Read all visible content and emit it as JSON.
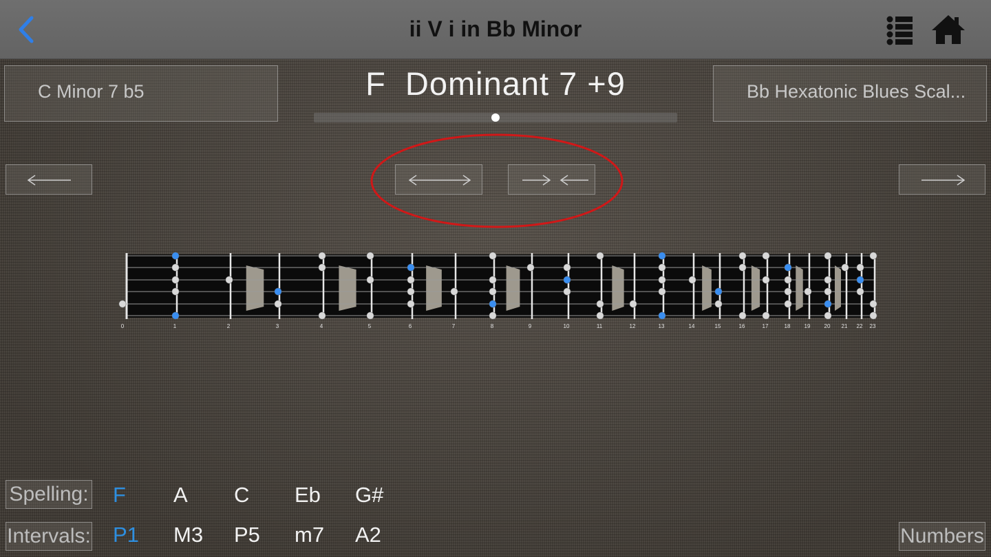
{
  "header": {
    "title": "ii V i in Bb Minor",
    "back_icon": "chevron-left-icon",
    "list_icon": "list-icon",
    "home_icon": "home-icon",
    "back_color": "#2f7fe8"
  },
  "chords": {
    "previous": "C  Minor 7 b5",
    "current": "F  Dominant 7 +9",
    "next": "Bb Hexatonic Blues Scal..."
  },
  "position_slider": {
    "value": 0.5
  },
  "navigation": {
    "prev_icon": "arrow-left-icon",
    "next_icon": "arrow-right-icon",
    "expand_icon": "arrows-expand-icon",
    "contract_icon": "arrows-contract-icon",
    "highlight_color": "#d01818"
  },
  "fretboard": {
    "fret_numbers": [
      "0",
      "1",
      "2",
      "3",
      "4",
      "5",
      "6",
      "7",
      "8",
      "9",
      "10",
      "11",
      "12",
      "13",
      "14",
      "15",
      "16",
      "17",
      "18",
      "19",
      "20",
      "21",
      "22",
      "23"
    ],
    "inlay_frets": [
      3,
      5,
      7,
      9,
      12,
      15,
      17,
      19,
      21
    ],
    "root_color": "#3a8ef0",
    "note_color": "#d8d8d8",
    "notes": [
      {
        "fret": 0,
        "string": 5,
        "root": false
      },
      {
        "fret": 1,
        "string": 1,
        "root": true
      },
      {
        "fret": 1,
        "string": 2,
        "root": false
      },
      {
        "fret": 1,
        "string": 3,
        "root": false
      },
      {
        "fret": 1,
        "string": 4,
        "root": false
      },
      {
        "fret": 1,
        "string": 6,
        "root": true
      },
      {
        "fret": 2,
        "string": 3,
        "root": false
      },
      {
        "fret": 3,
        "string": 4,
        "root": true
      },
      {
        "fret": 3,
        "string": 5,
        "root": false
      },
      {
        "fret": 4,
        "string": 1,
        "root": false
      },
      {
        "fret": 4,
        "string": 2,
        "root": false
      },
      {
        "fret": 4,
        "string": 6,
        "root": false
      },
      {
        "fret": 5,
        "string": 1,
        "root": false
      },
      {
        "fret": 5,
        "string": 3,
        "root": false
      },
      {
        "fret": 5,
        "string": 6,
        "root": false
      },
      {
        "fret": 6,
        "string": 2,
        "root": true
      },
      {
        "fret": 6,
        "string": 3,
        "root": false
      },
      {
        "fret": 6,
        "string": 4,
        "root": false
      },
      {
        "fret": 6,
        "string": 5,
        "root": false
      },
      {
        "fret": 7,
        "string": 4,
        "root": false
      },
      {
        "fret": 8,
        "string": 1,
        "root": false
      },
      {
        "fret": 8,
        "string": 3,
        "root": false
      },
      {
        "fret": 8,
        "string": 4,
        "root": false
      },
      {
        "fret": 8,
        "string": 5,
        "root": true
      },
      {
        "fret": 8,
        "string": 6,
        "root": false
      },
      {
        "fret": 9,
        "string": 2,
        "root": false
      },
      {
        "fret": 10,
        "string": 2,
        "root": false
      },
      {
        "fret": 10,
        "string": 3,
        "root": true
      },
      {
        "fret": 10,
        "string": 4,
        "root": false
      },
      {
        "fret": 11,
        "string": 1,
        "root": false
      },
      {
        "fret": 11,
        "string": 5,
        "root": false
      },
      {
        "fret": 11,
        "string": 6,
        "root": false
      },
      {
        "fret": 12,
        "string": 5,
        "root": false
      },
      {
        "fret": 13,
        "string": 1,
        "root": true
      },
      {
        "fret": 13,
        "string": 2,
        "root": false
      },
      {
        "fret": 13,
        "string": 3,
        "root": false
      },
      {
        "fret": 13,
        "string": 4,
        "root": false
      },
      {
        "fret": 13,
        "string": 6,
        "root": true
      },
      {
        "fret": 14,
        "string": 3,
        "root": false
      },
      {
        "fret": 15,
        "string": 4,
        "root": true
      },
      {
        "fret": 15,
        "string": 5,
        "root": false
      },
      {
        "fret": 16,
        "string": 1,
        "root": false
      },
      {
        "fret": 16,
        "string": 2,
        "root": false
      },
      {
        "fret": 16,
        "string": 6,
        "root": false
      },
      {
        "fret": 17,
        "string": 1,
        "root": false
      },
      {
        "fret": 17,
        "string": 3,
        "root": false
      },
      {
        "fret": 17,
        "string": 6,
        "root": false
      },
      {
        "fret": 18,
        "string": 2,
        "root": true
      },
      {
        "fret": 18,
        "string": 3,
        "root": false
      },
      {
        "fret": 18,
        "string": 4,
        "root": false
      },
      {
        "fret": 18,
        "string": 5,
        "root": false
      },
      {
        "fret": 19,
        "string": 4,
        "root": false
      },
      {
        "fret": 20,
        "string": 1,
        "root": false
      },
      {
        "fret": 20,
        "string": 3,
        "root": false
      },
      {
        "fret": 20,
        "string": 4,
        "root": false
      },
      {
        "fret": 20,
        "string": 5,
        "root": true
      },
      {
        "fret": 20,
        "string": 6,
        "root": false
      },
      {
        "fret": 21,
        "string": 2,
        "root": false
      },
      {
        "fret": 22,
        "string": 2,
        "root": false
      },
      {
        "fret": 22,
        "string": 3,
        "root": true
      },
      {
        "fret": 22,
        "string": 4,
        "root": false
      },
      {
        "fret": 23,
        "string": 1,
        "root": false
      },
      {
        "fret": 23,
        "string": 5,
        "root": false
      },
      {
        "fret": 23,
        "string": 6,
        "root": false
      }
    ]
  },
  "spelling": {
    "label": "Spelling:",
    "notes": [
      {
        "text": "F",
        "root": true
      },
      {
        "text": "A",
        "root": false
      },
      {
        "text": "C",
        "root": false
      },
      {
        "text": "Eb",
        "root": false
      },
      {
        "text": "G#",
        "root": false
      }
    ]
  },
  "intervals": {
    "label": "Intervals:",
    "notes": [
      {
        "text": "P1",
        "root": true
      },
      {
        "text": "M3",
        "root": false
      },
      {
        "text": "P5",
        "root": false
      },
      {
        "text": "m7",
        "root": false
      },
      {
        "text": "A2",
        "root": false
      }
    ]
  },
  "numbers_button": "Numbers"
}
